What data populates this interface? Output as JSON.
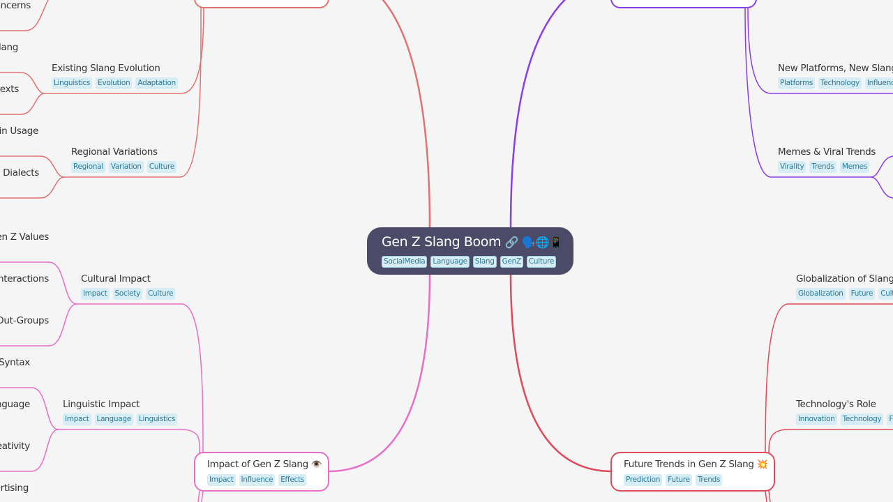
{
  "root": {
    "title": "Gen Z Slang Boom",
    "emoji": "🔗 🗣️🌐📱",
    "tags": [
      "SocialMedia",
      "Language",
      "Slang",
      "GenZ",
      "Culture"
    ]
  },
  "branches": {
    "impact": {
      "title": "Impact of Gen Z Slang",
      "emoji": "👁️",
      "tags": [
        "Impact",
        "Influence",
        "Effects"
      ],
      "color": "#e86fc8"
    },
    "future": {
      "title": "Future Trends in Gen Z Slang",
      "emoji": "💥",
      "tags": [
        "Prediction",
        "Future",
        "Trends"
      ],
      "color": "#e04a5c"
    },
    "top_left_color": "#e07272",
    "top_right_color": "#8a3ee8"
  },
  "subtopics": {
    "existing_slang": {
      "title": "Existing Slang Evolution",
      "tags": [
        "Linguistics",
        "Evolution",
        "Adaptation"
      ]
    },
    "regional": {
      "title": "Regional Variations",
      "tags": [
        "Regional",
        "Variation",
        "Culture"
      ]
    },
    "cultural": {
      "title": "Cultural Impact",
      "tags": [
        "Impact",
        "Society",
        "Culture"
      ]
    },
    "linguistic": {
      "title": "Linguistic Impact",
      "tags": [
        "Impact",
        "Language",
        "Linguistics"
      ]
    },
    "new_platforms": {
      "title": "New Platforms, New Slang",
      "tags": [
        "Platforms",
        "Technology",
        "Influence"
      ]
    },
    "memes": {
      "title": "Memes & Viral Trends",
      "tags": [
        "Virality",
        "Trends",
        "Memes"
      ]
    },
    "globalization": {
      "title": "Globalization of Slang",
      "tags": [
        "Globalization",
        "Future",
        "Culture"
      ]
    },
    "technology": {
      "title": "Technology's Role",
      "tags": [
        "Innovation",
        "Technology",
        "Future"
      ]
    }
  },
  "leaves": {
    "concerns": "Concerns",
    "slang": "Slang",
    "texts": "Contexts",
    "usage": "Differences in Usage",
    "dialects": "Accents and Dialects",
    "values": "Reflecting Gen Z Values",
    "interactions": "Social Interactions",
    "outgroups": "In-Groups and Out-Groups",
    "syntax": "Changes in Syntax",
    "language": "Evolution of Language",
    "creativity": "Linguistic Creativity",
    "advertising": "Slang in Advertising"
  }
}
